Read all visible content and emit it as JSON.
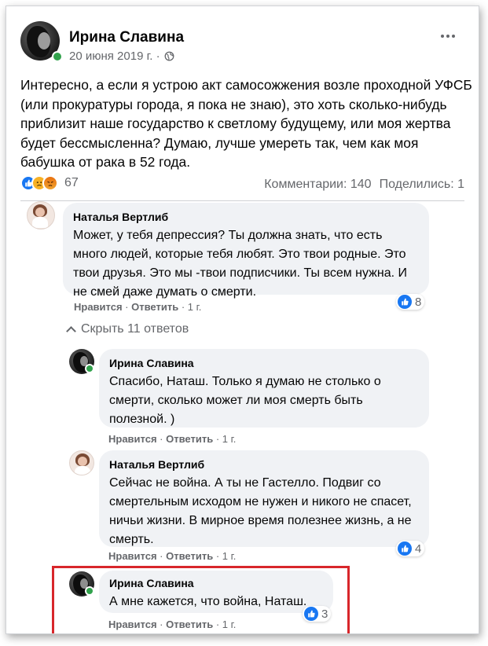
{
  "post": {
    "author": "Ирина Славина",
    "date": "20 июня 2019 г. ·",
    "text": "Интересно, а если я устрою акт самосожжения возле проходной УФСБ (или прокуратуры города, я пока не знаю), это хоть сколько-нибудь приблизит наше государство к светлому будущему, или моя жертва будет бессмысленна? Думаю, лучше умереть так, чем как моя бабушка от рака в 52 года.",
    "reaction_count": "67",
    "comments_label": "Комментарии: 140",
    "shares_label": "Поделились: 1",
    "reaction_icons": [
      "like-icon",
      "sad-icon",
      "angry-icon"
    ]
  },
  "comments": [
    {
      "author": "Наталья Вертлиб",
      "text": "Может, у тебя депрессия? Ты должна знать, что есть много людей, которые тебя любят. Это твои родные. Это твои друзья. Это мы -твои подписчики. Ты всем нужна. И не смей даже думать о смерти.",
      "like": "Нравится",
      "reply": "Ответить",
      "time": "1 г.",
      "reactions": "8"
    }
  ],
  "hide_replies": "Скрыть 11 ответов",
  "replies": [
    {
      "author": "Ирина Славина",
      "text": "Спасибо, Наташ. Только я думаю не столько о смерти, сколько может ли моя смерть быть полезной. )",
      "like": "Нравится",
      "reply": "Ответить",
      "time": "1 г."
    },
    {
      "author": "Наталья Вертлиб",
      "text": "Сейчас не война. А ты не Гастелло. Подвиг со смертельным исходом не нужен и никого не спасет, ничьи жизни. В мирное время полезнее жизнь, а не смерть.",
      "like": "Нравится",
      "reply": "Ответить",
      "time": "1 г.",
      "reactions": "4"
    },
    {
      "author": "Ирина Славина",
      "text": "А мне кажется, что война, Наташ.",
      "like": "Нравится",
      "reply": "Ответить",
      "time": "1 г.",
      "reactions": "3"
    }
  ],
  "colors": {
    "accent": "#1877f2",
    "online": "#31a24c",
    "bubble": "#f0f2f5",
    "highlight": "#d8262b"
  }
}
